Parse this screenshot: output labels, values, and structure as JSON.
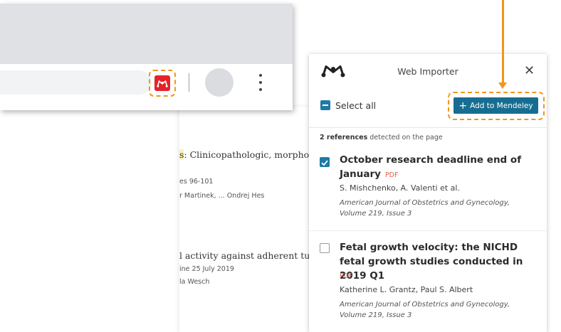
{
  "background_article": {
    "item1_title": "s: Clinicopathologic, morpholo",
    "item1_title_highlight": "s",
    "item1_meta1": "es 96-101",
    "item1_meta2": "r Martinek, ... Ondrej Hes",
    "item2_title": "l activity against adherent tumo",
    "item2_meta1": "ine 25 July 2019",
    "item2_meta2": "la Wesch"
  },
  "browser": {
    "extension_icon": "mendeley-icon",
    "menu_icon": "kebab-menu-icon"
  },
  "importer": {
    "title": "Web Importer",
    "close": "✕",
    "select_all_label": "Select all",
    "add_button_label": "Add to Mendeley",
    "ref_count_bold": "2 references",
    "ref_count_rest": " detected on the page",
    "references": [
      {
        "title_line1": "October research deadline end of",
        "title_line2": "January",
        "pdf": "PDF",
        "authors": "S. Mishchenko, A. Valenti et al.",
        "journal_line1": "American Journal of Obstetrics and Gynecology,",
        "journal_line2": "Volume 219, Issue 3",
        "checked": true
      },
      {
        "title_line1": "Fetal growth velocity: the NICHD",
        "title_line2": "fetal growth studies conducted in 2019 Q1",
        "pdf": "PDF",
        "authors": "Katherine L. Grantz, Paul S. Albert",
        "journal_line1": "American Journal of Obstetrics and Gynecology,",
        "journal_line2": "Volume 219, Issue 3",
        "checked": false
      }
    ]
  },
  "colors": {
    "accent": "#176d91",
    "highlight_outline": "#f0961d",
    "mendeley_red": "#e32329",
    "pdf": "#e0614e"
  }
}
